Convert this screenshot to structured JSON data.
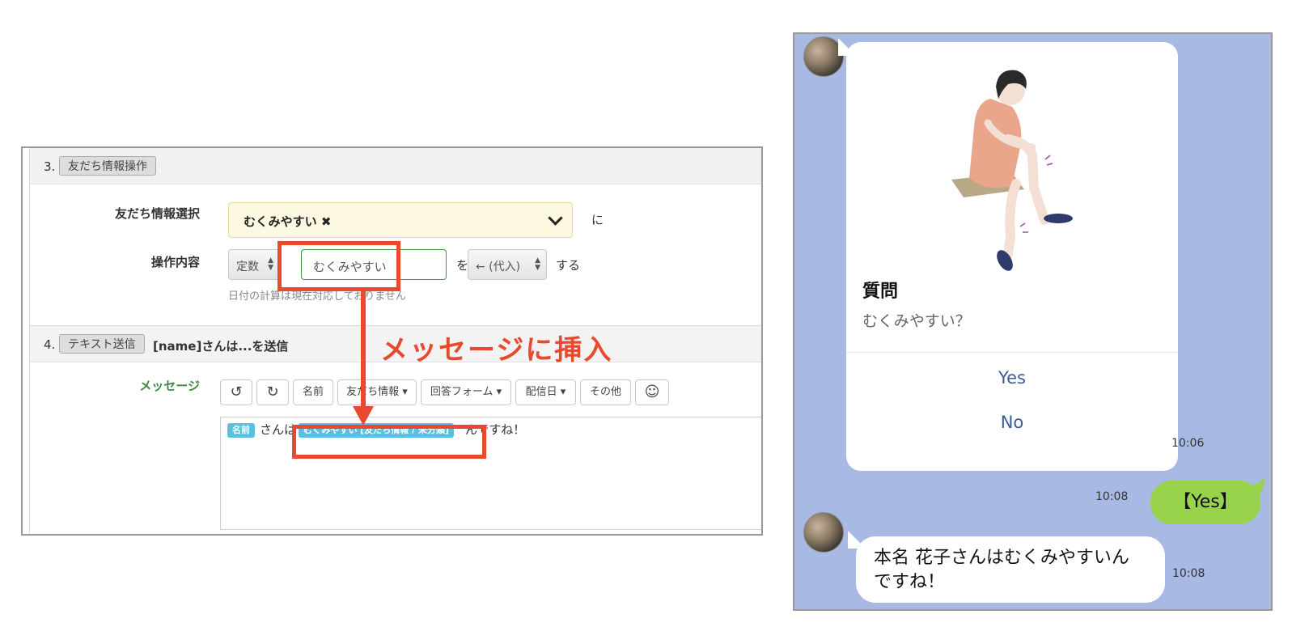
{
  "admin": {
    "section3": {
      "num": "3.",
      "tag": "友だち情報操作"
    },
    "friend_select": {
      "label": "友だち情報選択",
      "value": "むくみやすい ✖",
      "suffix": "に"
    },
    "operation": {
      "label": "操作内容",
      "type_value": "定数",
      "input_value": "むくみやすい",
      "particle": "を",
      "op_value": "← (代入)",
      "suffix": "する",
      "hint": "日付の計算は現在対応しておりません"
    },
    "section4": {
      "num": "4.",
      "tag": "テキスト送信",
      "title": "[name]さんは...を送信"
    },
    "message": {
      "label": "メッセージ",
      "toolbar": {
        "undo": "↺",
        "redo": "↻",
        "name": "名前",
        "friend_info": "友だち情報 ▾",
        "form": "回答フォーム ▾",
        "date": "配信日 ▾",
        "other": "その他",
        "emoji": "☺"
      },
      "chip_name": "名前",
      "text1": "さんは",
      "chip_info": "むくみやすい [友だち情報 / 未分類]",
      "text2": "んですね！"
    },
    "annotation": "メッセージに挿入"
  },
  "chat": {
    "card": {
      "title": "質問",
      "subtitle": "むくみやすい？",
      "btn_yes": "Yes",
      "btn_no": "No",
      "time": "10:06"
    },
    "user_msg": {
      "text": "【Yes】",
      "time": "10:08"
    },
    "bot_msg": {
      "line1": "本名 花子さんはむくみやすいん",
      "line2": "ですね！",
      "time": "10:08"
    }
  },
  "colors": {
    "accent_red": "#e84a2f",
    "chat_bg": "#a8b9e3",
    "line_green": "#99d34c",
    "chip_blue": "#5bc0de"
  }
}
